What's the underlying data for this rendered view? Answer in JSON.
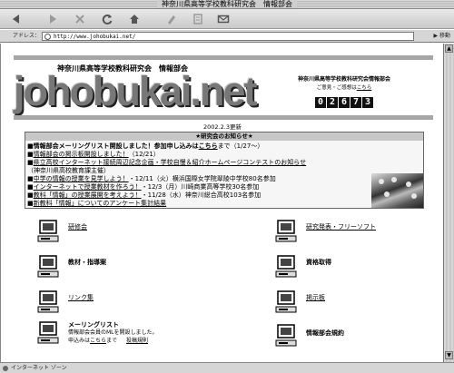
{
  "window": {
    "title": "神奈川県高等学校教科研究会　情報部会"
  },
  "toolbar": {
    "buttons": [
      "back-icon",
      "forward-icon",
      "stop-icon",
      "reload-icon",
      "home-icon",
      "favorites-icon",
      "history-icon",
      "mail-icon"
    ]
  },
  "addressbar": {
    "label": "アドレス：",
    "url": "http://www.johobukai.net/",
    "go_label": "▶ 移動"
  },
  "header": {
    "org_title": "神奈川県高等学校教科研究会　情報部会",
    "logo_text": "johobukai.net",
    "counter_org": "神奈川県高等学校教科研究会情報部会",
    "counter_since_prefix": "ご意見・ご感想は",
    "counter_since_link": "こちら",
    "counter_digits": [
      "0",
      "2",
      "6",
      "7",
      "3"
    ]
  },
  "updated": "2002.2.3更新",
  "news": {
    "heading": "★研究会のお知らせ★",
    "lines": [
      {
        "pre": "■情報部会メーリングリスト開設しました！参加申し込みは",
        "link": "こちら",
        "post": "まで（1/27～）"
      },
      {
        "pre": "■",
        "link": "情報部会の掲示板開設しました！",
        "post": "（12/21）"
      },
      {
        "pre": "■",
        "link": "県立高校インターネット接続周辺記念企画・学校自慢＆紹介ホームページコンテストのお知らせ",
        "post": ""
      },
      {
        "pre": "（神奈川県高校教育課主催）",
        "link": "",
        "post": ""
      },
      {
        "pre": "■",
        "link": "中学の情報の授業を見学しよう！",
        "post": "・12/11（火）横浜国際女学院翠陵中学校80名参加"
      },
      {
        "pre": "■",
        "link": "インターネットで授業教材を作ろう！",
        "post": "・12/3（月）川崎商業高等学校30名参加"
      },
      {
        "pre": "■",
        "link": "教科「情報」の授業展開を考えよう！",
        "post": "・11/28（水）神奈川総合高校103名参加"
      },
      {
        "pre": "■",
        "link": "新教科「情報」についてのアンケート集計結果",
        "post": ""
      }
    ]
  },
  "menu": {
    "left": [
      {
        "label": "研修会",
        "style": "link"
      },
      {
        "label": "教材・指導案",
        "style": "bold"
      },
      {
        "label": "リンク集",
        "style": "link"
      },
      {
        "label": "メーリングリスト",
        "style": "bold",
        "sub1": "情報部会会員のMLを開設しました。",
        "sub2_prefix": "申込みは",
        "sub2_link": "こちら",
        "sub2_suffix": "まで",
        "sub2_extra": "投稿規則"
      }
    ],
    "right": [
      {
        "label": "研究発表・フリーソフト",
        "style": "link"
      },
      {
        "label": "資格取得",
        "style": "bold"
      },
      {
        "label": "掲示板",
        "style": "link"
      },
      {
        "label": "情報部会規約",
        "style": "bold"
      }
    ]
  },
  "status": {
    "text": "インターネット ゾーン"
  }
}
